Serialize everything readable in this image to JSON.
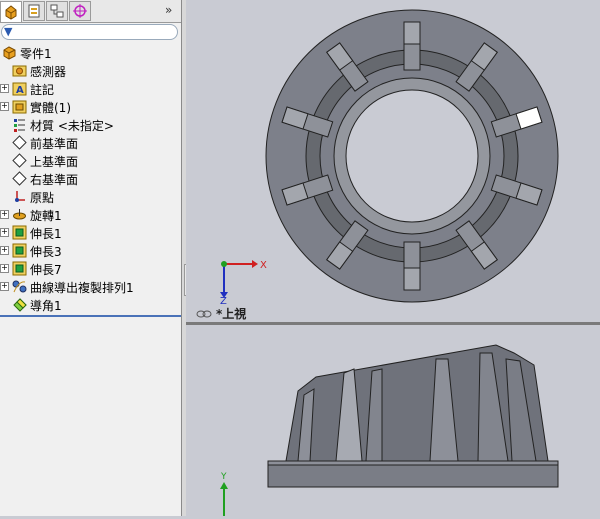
{
  "tree": {
    "items": [
      {
        "label": "零件1",
        "icon": "part-icon",
        "expand": ""
      },
      {
        "label": "感測器",
        "icon": "sensor-folder-icon",
        "expand": ""
      },
      {
        "label": "註記",
        "icon": "annotation-icon",
        "expand": "+"
      },
      {
        "label": "實體(1)",
        "icon": "solid-bodies-icon",
        "expand": "+"
      },
      {
        "label": "材質 <未指定>",
        "icon": "material-icon",
        "expand": ""
      },
      {
        "label": "前基準面",
        "icon": "plane-icon",
        "expand": ""
      },
      {
        "label": "上基準面",
        "icon": "plane-icon",
        "expand": ""
      },
      {
        "label": "右基準面",
        "icon": "plane-icon",
        "expand": ""
      },
      {
        "label": "原點",
        "icon": "origin-icon",
        "expand": ""
      },
      {
        "label": "旋轉1",
        "icon": "revolve-icon",
        "expand": "+"
      },
      {
        "label": "伸長1",
        "icon": "extrude-icon",
        "expand": "+"
      },
      {
        "label": "伸長3",
        "icon": "extrude-icon",
        "expand": "+"
      },
      {
        "label": "伸長7",
        "icon": "extrude-icon",
        "expand": "+"
      },
      {
        "label": "曲線導出複製排列1",
        "icon": "curve-pattern-icon",
        "expand": "+"
      },
      {
        "label": "導角1",
        "icon": "chamfer-icon",
        "expand": ""
      }
    ]
  },
  "tabs": {
    "expand_label": "»"
  },
  "viewport": {
    "view_name": "*上視",
    "axis_x": "X",
    "axis_z": "Z",
    "axis_y": "Y"
  }
}
